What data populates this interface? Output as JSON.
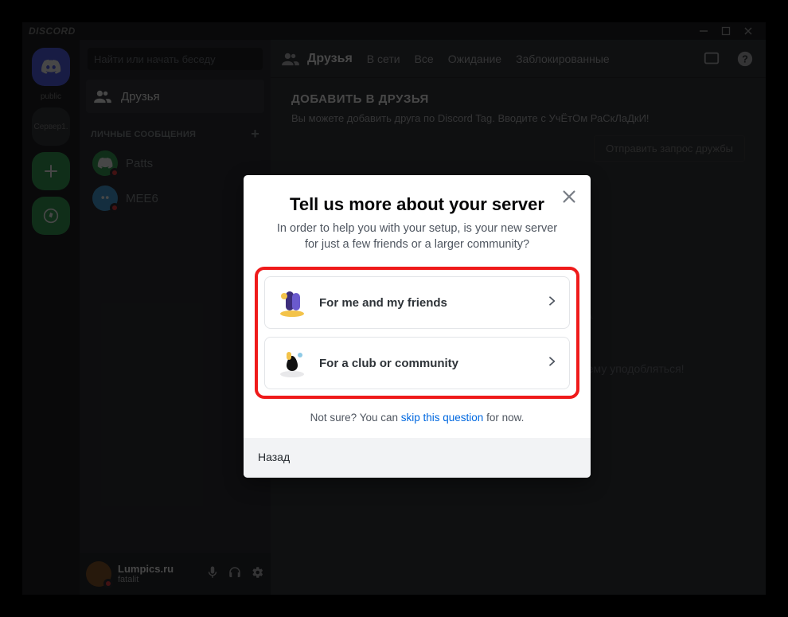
{
  "titlebar": {
    "brand": "DISCORD"
  },
  "rail": {
    "labels": {
      "public": "public",
      "server2": "Сервер1."
    }
  },
  "sidebar": {
    "search_placeholder": "Найти или начать беседу",
    "friends_label": "Друзья",
    "dm_header": "ЛИЧНЫЕ СООБЩЕНИЯ",
    "dms": [
      {
        "name": "Patts"
      },
      {
        "name": "MEE6"
      }
    ]
  },
  "user": {
    "name": "Lumpics.ru",
    "sub": "fatalit"
  },
  "topbar": {
    "lead": "Друзья",
    "tabs": {
      "online": "В сети",
      "all": "Все",
      "pending": "Ожидание",
      "blocked": "Заблокированные"
    }
  },
  "content": {
    "title": "ДОБАВИТЬ В ДРУЗЬЯ",
    "hint": "Вы можете добавить друга по Discord Tag. Вводите с УчЁтОм РаСкЛаДкИ!",
    "send_button": "Отправить запрос дружбы",
    "wumpus_text": "Вампус ждёт друзей. Но вам не обязательно ему уподобляться!"
  },
  "modal": {
    "title": "Tell us more about your server",
    "subtitle": "In order to help you with your setup, is your new server for just a few friends or a larger community?",
    "options": [
      {
        "label": "For me and my friends"
      },
      {
        "label": "For a club or community"
      }
    ],
    "skip_prefix": "Not sure? You can ",
    "skip_link": "skip this question",
    "skip_suffix": " for now.",
    "back": "Назад"
  }
}
